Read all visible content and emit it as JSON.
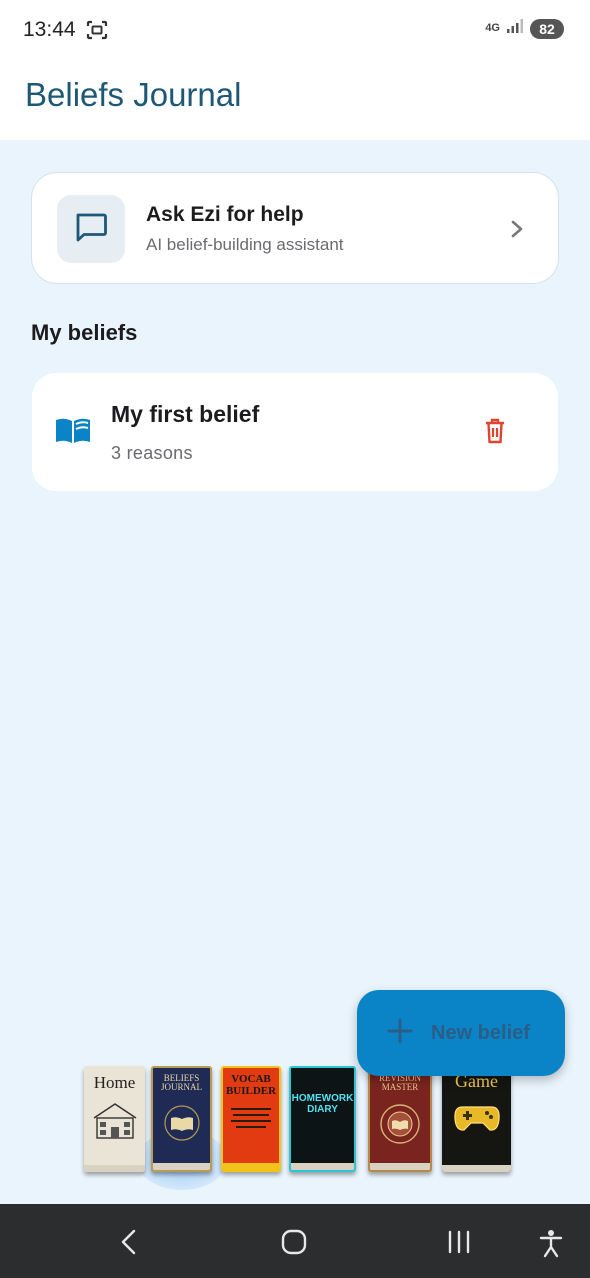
{
  "status_bar": {
    "time": "13:44",
    "network": "4G",
    "battery": "82"
  },
  "header": {
    "title": "Beliefs Journal"
  },
  "help_card": {
    "title": "Ask Ezi for help",
    "subtitle": "AI belief-building assistant",
    "icon": "chat-bubble-icon"
  },
  "beliefs_section": {
    "title": "My beliefs",
    "items": [
      {
        "title": "My first belief",
        "count": "3 reasons",
        "icon": "open-book-icon"
      }
    ]
  },
  "fab": {
    "label": "New belief",
    "icon": "plus-icon"
  },
  "bookshelf": {
    "books": [
      {
        "label": "Home"
      },
      {
        "label": "BELIEFS JOURNAL"
      },
      {
        "label": "VOCAB BUILDER"
      },
      {
        "label": "HOMEWORK DIARY"
      },
      {
        "label": "REVISION MASTER"
      },
      {
        "label": "Game"
      }
    ]
  },
  "colors": {
    "accent": "#0a84c6",
    "title": "#1d5877",
    "delete": "#e0442f",
    "background": "#eaf4fc"
  }
}
